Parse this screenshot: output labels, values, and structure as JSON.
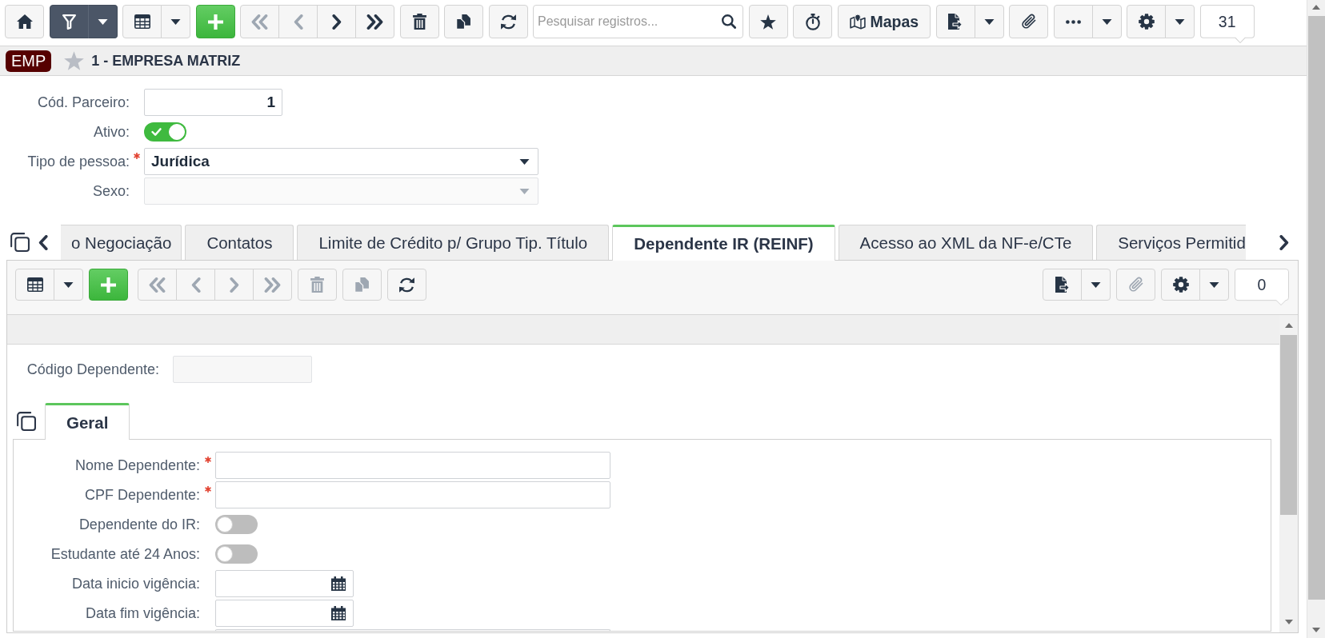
{
  "toolbar": {
    "items": [
      {
        "kind": "home",
        "disabled": false,
        "active": false
      },
      {
        "kind": "filter",
        "disabled": false,
        "active": true,
        "menu": true
      },
      {
        "kind": "grid",
        "disabled": false,
        "active": false,
        "menu": true
      },
      {
        "kind": "add",
        "disabled": false,
        "active": false
      },
      {
        "kind": "first",
        "disabled": true,
        "active": false
      },
      {
        "kind": "prev",
        "disabled": true,
        "active": false
      },
      {
        "kind": "next",
        "disabled": false,
        "active": false
      },
      {
        "kind": "last",
        "disabled": false,
        "active": false
      },
      {
        "kind": "delete",
        "disabled": false,
        "active": false
      },
      {
        "kind": "copy",
        "disabled": false,
        "active": false
      },
      {
        "kind": "refresh",
        "disabled": false,
        "active": false
      },
      {
        "kind": "search",
        "placeholder": "Pesquisar registros..."
      },
      {
        "kind": "favorite",
        "disabled": false,
        "active": false
      },
      {
        "kind": "timer",
        "disabled": false,
        "active": false
      },
      {
        "kind": "maps",
        "label": "Mapas",
        "disabled": false,
        "active": false
      },
      {
        "kind": "export",
        "disabled": false,
        "active": false,
        "menu": true
      },
      {
        "kind": "attach",
        "disabled": false,
        "active": false
      },
      {
        "kind": "more",
        "disabled": false,
        "active": false,
        "menu": true
      },
      {
        "kind": "settings",
        "disabled": false,
        "active": false,
        "menu": true
      },
      {
        "kind": "count",
        "value": "31"
      }
    ]
  },
  "header": {
    "badge": "EMP",
    "favorite": false,
    "title": "1 - EMPRESA MATRIZ"
  },
  "fields": [
    {
      "kind": "number",
      "label": "Cód. Parceiro:",
      "value": "1",
      "required": false,
      "disabled": false
    },
    {
      "kind": "toggle",
      "label": "Ativo:",
      "on": true,
      "required": false,
      "disabled": false
    },
    {
      "kind": "select",
      "label": "Tipo de pessoa:",
      "value": "Jurídica",
      "required": true,
      "disabled": false
    },
    {
      "kind": "select",
      "label": "Sexo:",
      "required": false,
      "disabled": true
    }
  ],
  "tabs": [
    {
      "label": "o Negociação",
      "selected": false
    },
    {
      "label": "Contatos",
      "selected": false
    },
    {
      "label": "Limite de Crédito p/ Grupo Tip. Título",
      "selected": false
    },
    {
      "label": "Dependente IR (REINF)",
      "selected": true
    },
    {
      "label": "Acesso ao XML da NF-e/CTe",
      "selected": false
    },
    {
      "label": "Serviços Permitid",
      "selected": false
    }
  ],
  "detail": {
    "toolbar": {
      "left": [
        {
          "kind": "grid",
          "disabled": false,
          "menu": true
        },
        {
          "kind": "add",
          "disabled": false
        },
        {
          "kind": "first",
          "disabled": true
        },
        {
          "kind": "prev",
          "disabled": true
        },
        {
          "kind": "next",
          "disabled": true
        },
        {
          "kind": "last",
          "disabled": true
        },
        {
          "kind": "delete",
          "disabled": true
        },
        {
          "kind": "copy",
          "disabled": true
        },
        {
          "kind": "refresh",
          "disabled": false
        }
      ],
      "right": [
        {
          "kind": "export",
          "disabled": false,
          "menu": true
        },
        {
          "kind": "attach",
          "disabled": true
        },
        {
          "kind": "settings",
          "disabled": false,
          "menu": true
        },
        {
          "kind": "count",
          "value": "0"
        }
      ]
    },
    "fields": [
      {
        "kind": "code",
        "label": "Código Dependente:",
        "required": false,
        "disabled": true
      }
    ],
    "tabs": [
      {
        "label": "Geral",
        "selected": true
      }
    ],
    "tab_fields": [
      {
        "kind": "text",
        "label": "Nome Dependente:",
        "required": true,
        "disabled": false
      },
      {
        "kind": "text",
        "label": "CPF Dependente:",
        "required": true,
        "disabled": false
      },
      {
        "kind": "toggle",
        "label": "Dependente do IR:",
        "on": false,
        "required": false,
        "disabled": false
      },
      {
        "kind": "toggle",
        "label": "Estudante até 24 Anos:",
        "on": false,
        "required": false,
        "disabled": false
      },
      {
        "kind": "date",
        "label": "Data inicio vigência:",
        "required": false,
        "disabled": false
      },
      {
        "kind": "date",
        "label": "Data fim vigência:",
        "required": false,
        "disabled": false
      },
      {
        "kind": "text",
        "required": false,
        "disabled": false
      }
    ]
  }
}
